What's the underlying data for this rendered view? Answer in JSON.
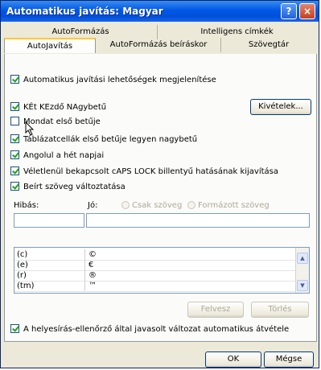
{
  "window": {
    "title": "Automatikus javítás: Magyar",
    "help_glyph": "?",
    "close_glyph": "×"
  },
  "tabs_back": [
    "AutoFormázás",
    "Intelligens címkék"
  ],
  "tabs_front": [
    "AutoJavítás",
    "AutoFormázás beíráskor",
    "Szövegtár"
  ],
  "active_tab": "AutoJavítás",
  "checkboxes": {
    "show_buttons": {
      "label": "Automatikus javítási lehetőségek megjelenítése",
      "checked": true
    },
    "two_initial_caps": {
      "label": "KÉt KEzdő NAgybetű",
      "checked": true
    },
    "sentence_first": {
      "label": "Mondat első betűje",
      "checked": false
    },
    "table_cells": {
      "label": "Táblázatcellák első betűje legyen nagybetű",
      "checked": true
    },
    "day_names": {
      "label": "Angolul a hét napjai",
      "checked": true
    },
    "caps_lock": {
      "label": "Véletlenül bekapcsolt cAPS LOCK billentyű hatásának kijavítása",
      "checked": true
    },
    "replace_text": {
      "label": "Beírt szöveg változtatása",
      "checked": true
    },
    "spell_suggestions": {
      "label": "A helyesírás-ellenőrző által javasolt változat automatikus átvétele",
      "checked": true
    }
  },
  "exceptions_button": "Kivételek...",
  "replace": {
    "label_from": "Hibás:",
    "label_to": "Jó:",
    "radio_plain": "Csak szöveg",
    "radio_formatted": "Formázott szöveg",
    "from_value": "",
    "to_value": ""
  },
  "list_rows": [
    {
      "from": "(c)",
      "to": "©"
    },
    {
      "from": "(e)",
      "to": "€"
    },
    {
      "from": "(r)",
      "to": "®"
    },
    {
      "from": "(tm)",
      "to": "™"
    }
  ],
  "buttons": {
    "replace": "Felvesz",
    "delete": "Törlés",
    "ok": "OK",
    "cancel": "Mégse"
  },
  "scroll_up": "▲",
  "scroll_down": "▼"
}
